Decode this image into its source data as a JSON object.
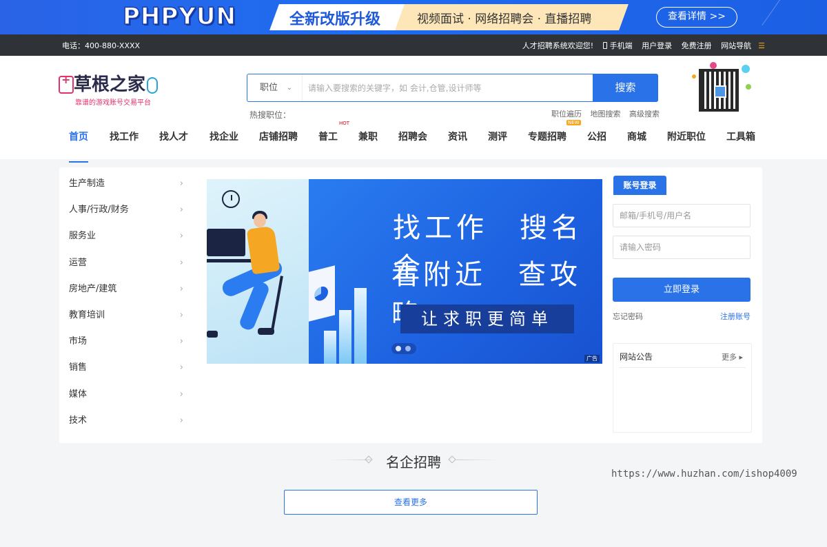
{
  "banner": {
    "brand": "PHPYUN",
    "headline": "全新改版升级",
    "features": "视频面试 · 网络招聘会 · 直播招聘",
    "detail_button": "查看详情 >>"
  },
  "topbar": {
    "phone": "电话：400-880-XXXX",
    "welcome": "人才招聘系统欢迎您!",
    "mobile": "手机端",
    "login": "用户登录",
    "register": "免费注册",
    "site_nav": "网站导航"
  },
  "logo": {
    "title": "草根之家",
    "subtitle": "靠谱的游戏账号交易平台"
  },
  "search": {
    "type": "职位",
    "placeholder": "请输入要搜索的关键字，如 会计,仓管,设计师等",
    "button": "搜索",
    "hot_label": "热搜职位：",
    "links": [
      "职位遍历",
      "地图搜索",
      "高级搜索"
    ]
  },
  "nav": {
    "items": [
      "首页",
      "找工作",
      "找人才",
      "找企业",
      "店铺招聘",
      "普工",
      "兼职",
      "招聘会",
      "资讯",
      "测评",
      "专题招聘",
      "公招",
      "商城",
      "附近职位",
      "工具箱"
    ],
    "hot_tag": "HOT",
    "new_tag": "NEW"
  },
  "categories": [
    "生产制造",
    "人事/行政/财务",
    "服务业",
    "运营",
    "房地产/建筑",
    "教育培训",
    "市场",
    "销售",
    "媒体",
    "技术"
  ],
  "hero": {
    "line1": "找工作　搜名企",
    "line2": "看附近　查攻略",
    "slogan": "让求职更简单",
    "ad_tag": "广告"
  },
  "login": {
    "tab": "账号登录",
    "username_placeholder": "邮箱/手机号/用户名",
    "password_placeholder": "请输入密码",
    "submit": "立即登录",
    "forgot": "忘记密码",
    "register": "注册账号"
  },
  "notice": {
    "title": "网站公告",
    "more": "更多"
  },
  "section": {
    "title": "名企招聘",
    "view_more": "查看更多"
  },
  "watermark": "https://www.huzhan.com/ishop4009",
  "colors": {
    "accent": "#2a72e8",
    "topbar": "#2f3236",
    "highlight": "#f5a623"
  }
}
